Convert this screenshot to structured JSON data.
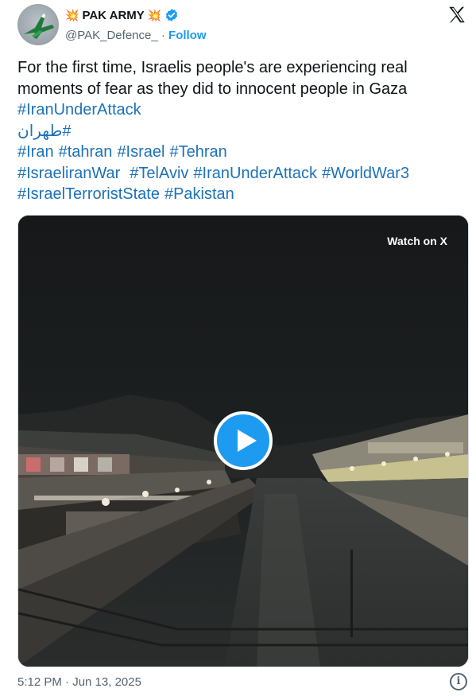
{
  "author": {
    "name": "PAK ARMY",
    "handle": "@PAK_Defence_",
    "separator": "·",
    "follow_label": "Follow",
    "badge_icon": "collision-emoji",
    "verified_icon": "blue-checkmark",
    "verified_color": "#1d9bf0"
  },
  "tweet": {
    "text_line_1": "For the first time, Israelis people's are experiencing real",
    "text_line_2": "moments of fear as they did to innocent people in Gaza",
    "hashtags_line_1": [
      "#IranUnderAttack"
    ],
    "hashtags_line_2": [
      "#طهران"
    ],
    "hashtags_line_3": [
      "#Iran",
      "#tahran",
      "#Israel",
      "#Tehran"
    ],
    "hashtags_line_4": [
      "#IsraeliranWar",
      "#TelAviv",
      "#IranUnderAttack",
      "#WorldWar3"
    ],
    "hashtags_line_5": [
      "#IsraelTerroristState",
      "#Pakistan"
    ],
    "hashtag_color": "#1d72b8"
  },
  "media": {
    "watch_label": "Watch on X",
    "play_icon": "play-icon",
    "play_color": "#1d9bf0"
  },
  "footer": {
    "timestamp": "5:12 PM · Jun 13, 2025",
    "info_icon": "info-icon"
  },
  "brand": {
    "logo_icon": "x-logo"
  }
}
